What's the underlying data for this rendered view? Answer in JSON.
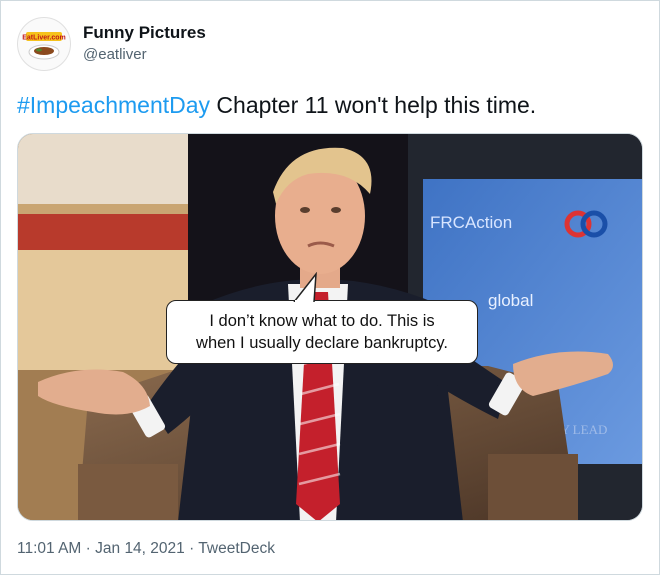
{
  "author": {
    "name": "Funny Pictures",
    "handle": "@eatliver",
    "avatar_logo_text": "EatLiver.com"
  },
  "tweet": {
    "hashtag": "#ImpeachmentDay",
    "text": " Chapter 11 won't help this time."
  },
  "media": {
    "speech_bubble": [
      "I don’t know what to do. This is",
      "when I usually declare bankruptcy."
    ],
    "background_sign_texts": [
      "FRCAction",
      "global",
      "MILY LEAD"
    ]
  },
  "meta": {
    "time": "11:01 AM",
    "separator": "·",
    "date": "Jan 14, 2021",
    "source": "TweetDeck"
  },
  "colors": {
    "link": "#1d9bf0",
    "text": "#0f1419",
    "muted": "#536471",
    "border": "#cfd9de"
  }
}
